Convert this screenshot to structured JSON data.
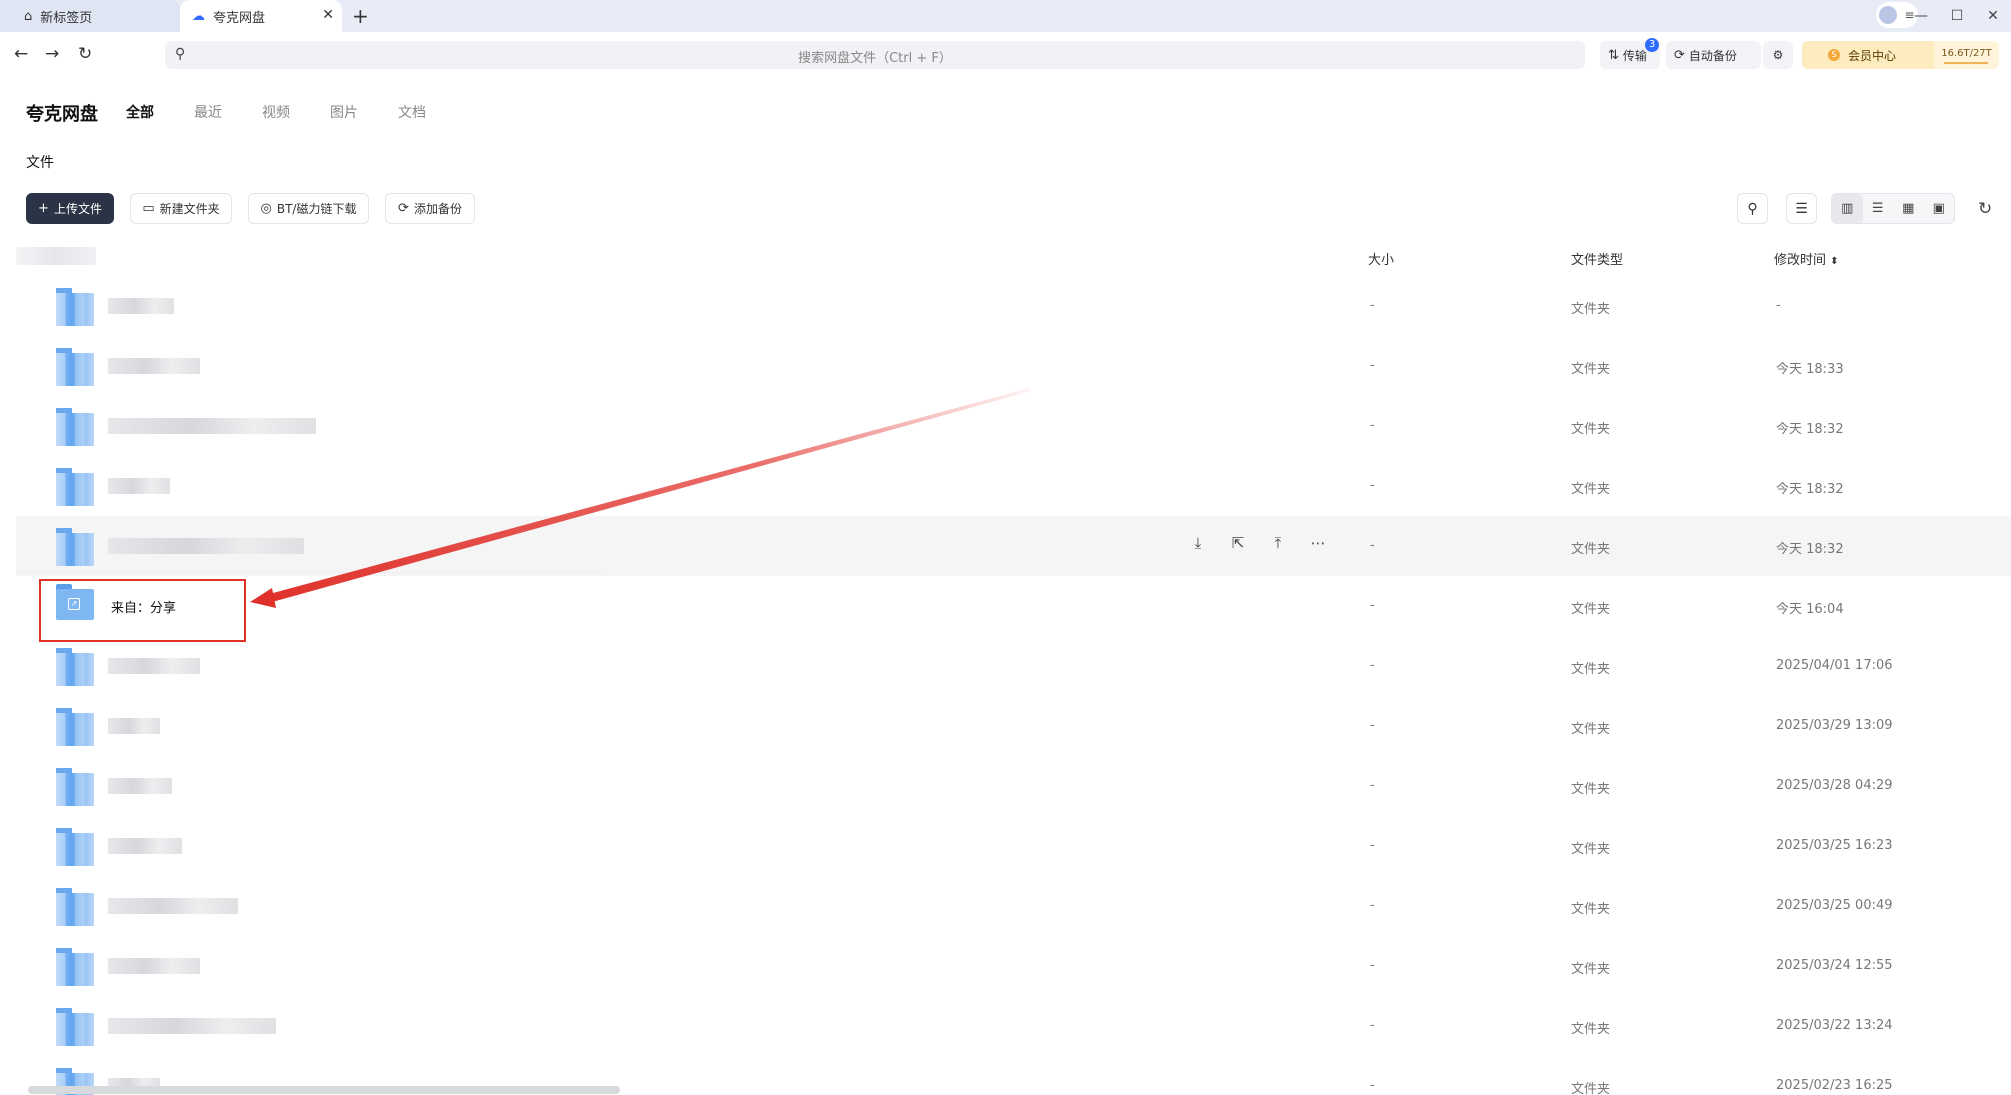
{
  "tabs": [
    {
      "label": "新标签页",
      "icon": "home-icon"
    },
    {
      "label": "夸克网盘",
      "icon": "cloud-icon",
      "active": true
    }
  ],
  "search": {
    "placeholder": "搜索网盘文件（Ctrl + F）"
  },
  "toolbar_top": {
    "transfer_label": "传输",
    "transfer_badge": "3",
    "backup_label": "自动备份",
    "vip_label": "会员中心",
    "storage": "16.6T/27T"
  },
  "app": {
    "brand": "夸克网盘",
    "categories": [
      "全部",
      "最近",
      "视频",
      "图片",
      "文档"
    ],
    "section": "文件"
  },
  "actions": {
    "upload": "上传文件",
    "new_folder": "新建文件夹",
    "bt_download": "BT/磁力链下载",
    "add_backup": "添加备份"
  },
  "table": {
    "headers": {
      "size": "大小",
      "type": "文件类型",
      "modified": "修改时间"
    },
    "rows": [
      {
        "size": "-",
        "type": "文件夹",
        "modified": "-"
      },
      {
        "size": "-",
        "type": "文件夹",
        "modified": "今天 18:33"
      },
      {
        "size": "-",
        "type": "文件夹",
        "modified": "今天 18:32"
      },
      {
        "size": "-",
        "type": "文件夹",
        "modified": "今天 18:32"
      },
      {
        "size": "-",
        "type": "文件夹",
        "modified": "今天 18:32"
      },
      {
        "name": "来自：分享",
        "size": "-",
        "type": "文件夹",
        "modified": "今天 16:04"
      },
      {
        "size": "-",
        "type": "文件夹",
        "modified": "2025/04/01 17:06"
      },
      {
        "size": "-",
        "type": "文件夹",
        "modified": "2025/03/29 13:09"
      },
      {
        "size": "-",
        "type": "文件夹",
        "modified": "2025/03/28 04:29"
      },
      {
        "size": "-",
        "type": "文件夹",
        "modified": "2025/03/25 16:23"
      },
      {
        "size": "-",
        "type": "文件夹",
        "modified": "2025/03/25 00:49"
      },
      {
        "size": "-",
        "type": "文件夹",
        "modified": "2025/03/24 12:55"
      },
      {
        "size": "-",
        "type": "文件夹",
        "modified": "2025/03/22 13:24"
      },
      {
        "size": "-",
        "type": "文件夹",
        "modified": "2025/02/23 16:25"
      }
    ]
  },
  "colors": {
    "annotation": "#e0302a",
    "primary_button": "#2b3446",
    "folder": "#62a5ef"
  }
}
